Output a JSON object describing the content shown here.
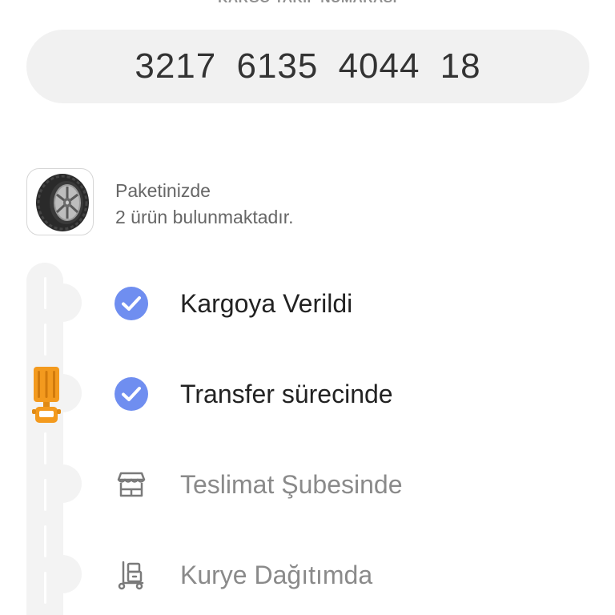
{
  "tracking": {
    "label": "KARGO TAKİP NUMARASI",
    "number": "3217  6135  4044  18"
  },
  "package": {
    "line1": "Paketinizde",
    "line2": "2 ürün bulunmaktadır.",
    "thumbnail_icon": "tire-icon"
  },
  "steps": [
    {
      "label": "Kargoya Verildi",
      "status": "done",
      "icon": "check-circle-icon"
    },
    {
      "label": "Transfer sürecinde",
      "status": "done",
      "icon": "check-circle-icon"
    },
    {
      "label": "Teslimat Şubesinde",
      "status": "pending",
      "icon": "store-icon"
    },
    {
      "label": "Kurye Dağıtımda",
      "status": "pending",
      "icon": "courier-trolley-icon"
    }
  ],
  "colors": {
    "check": "#6f8ef0",
    "truck": "#f39a1e",
    "pill": "#f1f1f1",
    "road": "#f3f3f3"
  }
}
